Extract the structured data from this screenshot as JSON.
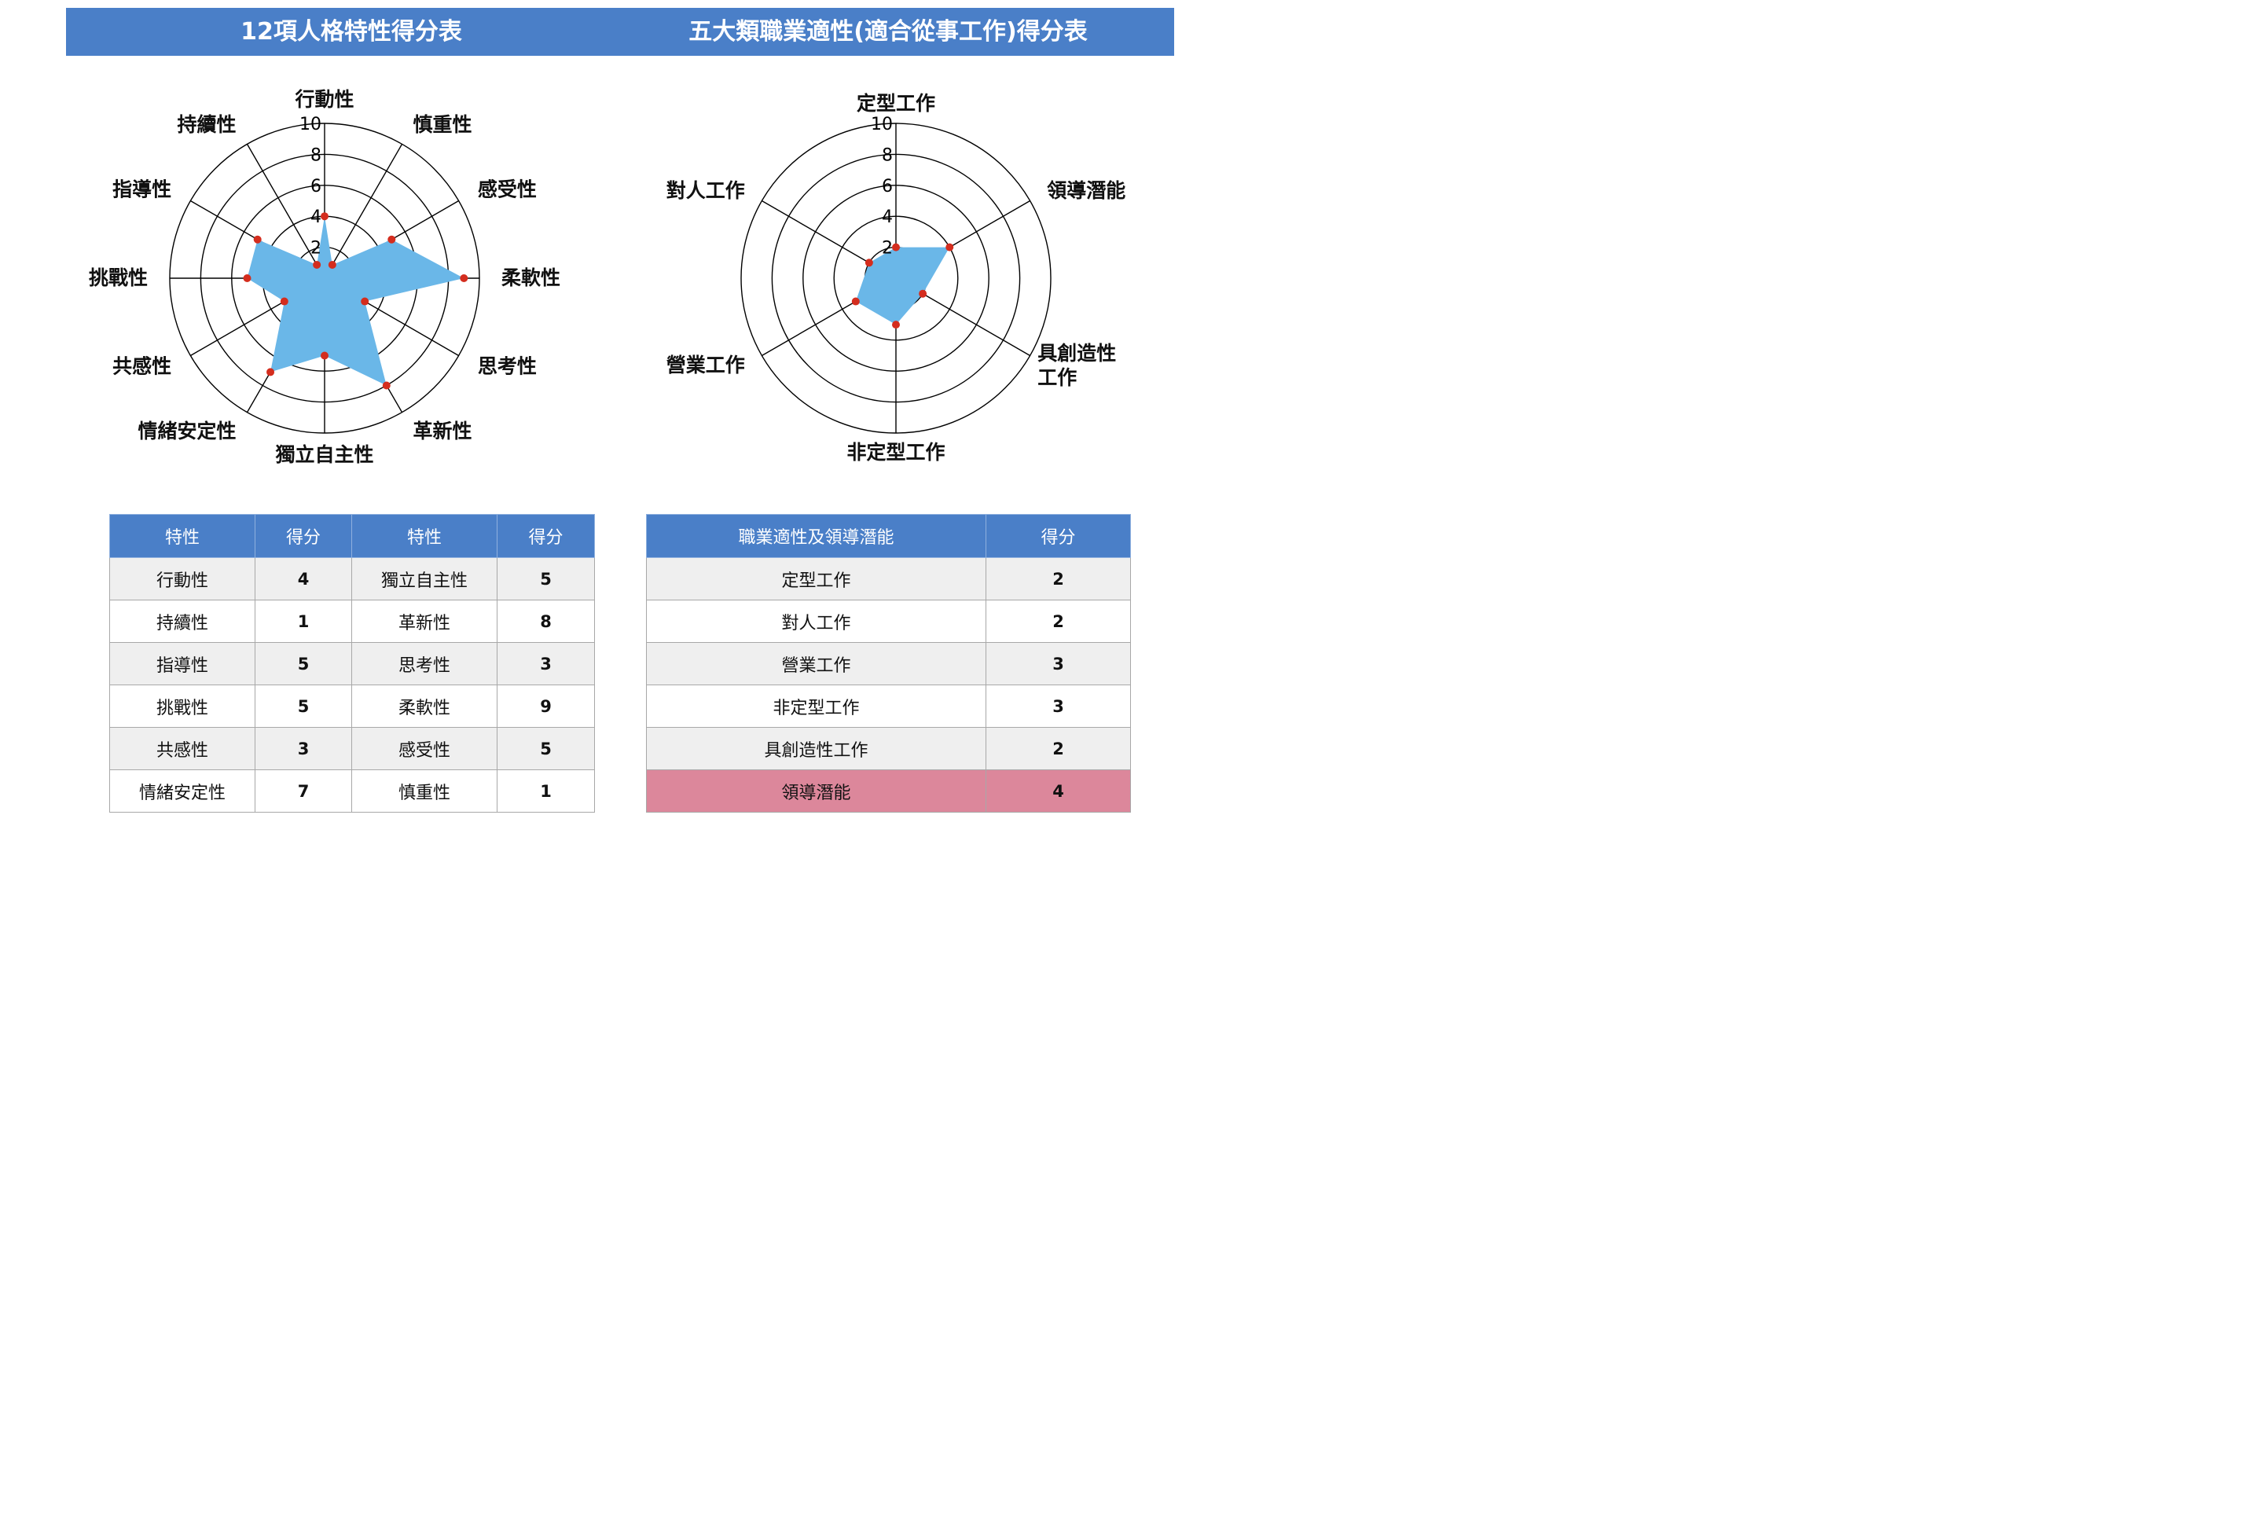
{
  "header": {
    "left_title": "12項人格特性得分表",
    "right_title": "五大類職業適性(適合從事工作)得分表"
  },
  "chart_data": [
    {
      "type": "radar",
      "title": "12項人格特性得分表",
      "axes": [
        "行動性",
        "慎重性",
        "感受性",
        "柔軟性",
        "思考性",
        "革新性",
        "獨立自主性",
        "情緒安定性",
        "共感性",
        "挑戰性",
        "指導性",
        "持續性"
      ],
      "values": [
        4,
        1,
        5,
        9,
        3,
        8,
        5,
        7,
        3,
        5,
        5,
        1
      ],
      "r_ticks": [
        "2",
        "4",
        "6",
        "8",
        "10"
      ],
      "r_range": [
        0,
        10
      ],
      "fill_color": "#6ab7e8",
      "marker_color": "#d42d1e"
    },
    {
      "type": "radar",
      "title": "五大類職業適性(適合從事工作)得分表",
      "axes": [
        "定型工作",
        "領導潛能",
        "具創造性工作",
        "非定型工作",
        "營業工作",
        "對人工作"
      ],
      "values": [
        2,
        4,
        2,
        3,
        3,
        2
      ],
      "r_ticks": [
        "2",
        "4",
        "6",
        "8",
        "10"
      ],
      "r_range": [
        0,
        10
      ],
      "fill_color": "#6ab7e8",
      "marker_color": "#d42d1e"
    }
  ],
  "traits_table": {
    "headers": [
      "特性",
      "得分",
      "特性",
      "得分"
    ],
    "rows": [
      [
        "行動性",
        "4",
        "獨立自主性",
        "5"
      ],
      [
        "持續性",
        "1",
        "革新性",
        "8"
      ],
      [
        "指導性",
        "5",
        "思考性",
        "3"
      ],
      [
        "挑戰性",
        "5",
        "柔軟性",
        "9"
      ],
      [
        "共感性",
        "3",
        "感受性",
        "5"
      ],
      [
        "情緒安定性",
        "7",
        "慎重性",
        "1"
      ]
    ]
  },
  "career_table": {
    "headers": [
      "職業適性及領導潛能",
      "得分"
    ],
    "rows": [
      [
        "定型工作",
        "2"
      ],
      [
        "對人工作",
        "2"
      ],
      [
        "營業工作",
        "3"
      ],
      [
        "非定型工作",
        "3"
      ],
      [
        "具創造性工作",
        "2"
      ],
      [
        "領導潛能",
        "4"
      ]
    ],
    "highlight_color": "#dc879b"
  }
}
